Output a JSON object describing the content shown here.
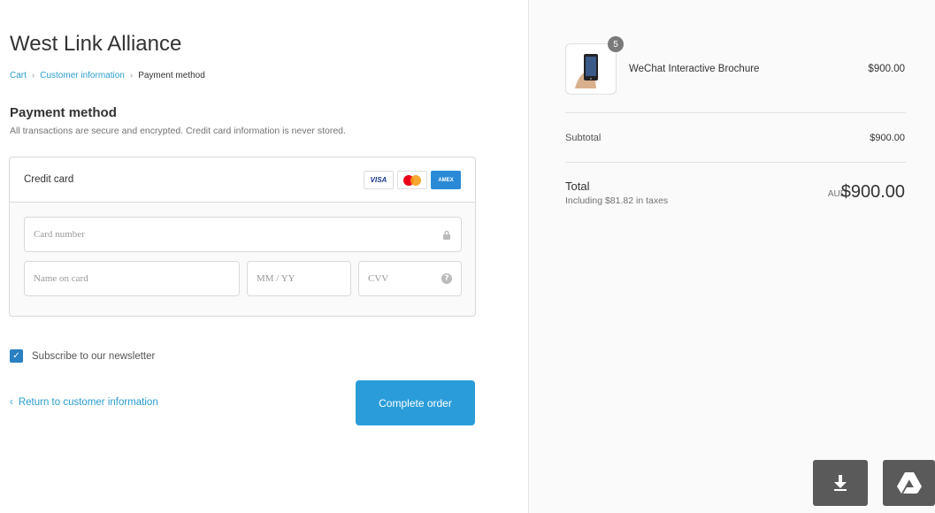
{
  "shop": {
    "title": "West Link Alliance"
  },
  "breadcrumb": {
    "cart": "Cart",
    "customer_info": "Customer information",
    "payment": "Payment method"
  },
  "payment": {
    "title": "Payment method",
    "description": "All transactions are secure and encrypted. Credit card information is never stored.",
    "method_label": "Credit card",
    "brands": {
      "visa": "VISA",
      "amex": "AMEX"
    },
    "fields": {
      "card_number_placeholder": "Card number",
      "name_placeholder": "Name on card",
      "expiry_placeholder": "MM / YY",
      "cvv_placeholder": "CVV"
    }
  },
  "newsletter": {
    "label": "Subscribe to our newsletter",
    "checked": true
  },
  "actions": {
    "return_label": "Return to customer information",
    "complete_label": "Complete order"
  },
  "summary": {
    "product": {
      "name": "WeChat Interactive Brochure",
      "price": "$900.00",
      "quantity": "5"
    },
    "subtotal_label": "Subtotal",
    "subtotal_value": "$900.00",
    "total_label": "Total",
    "taxes_note": "Including $81.82 in taxes",
    "currency": "AUD",
    "total_value": "$900.00"
  },
  "icons": {
    "lock": "lock-icon",
    "help": "question-icon",
    "download": "download-icon",
    "drive": "google-drive-icon"
  },
  "colors": {
    "accent": "#2a9dd9",
    "link": "#2a9dcc",
    "checkbox": "#2a7fc1",
    "fab": "#5a5a5a"
  }
}
